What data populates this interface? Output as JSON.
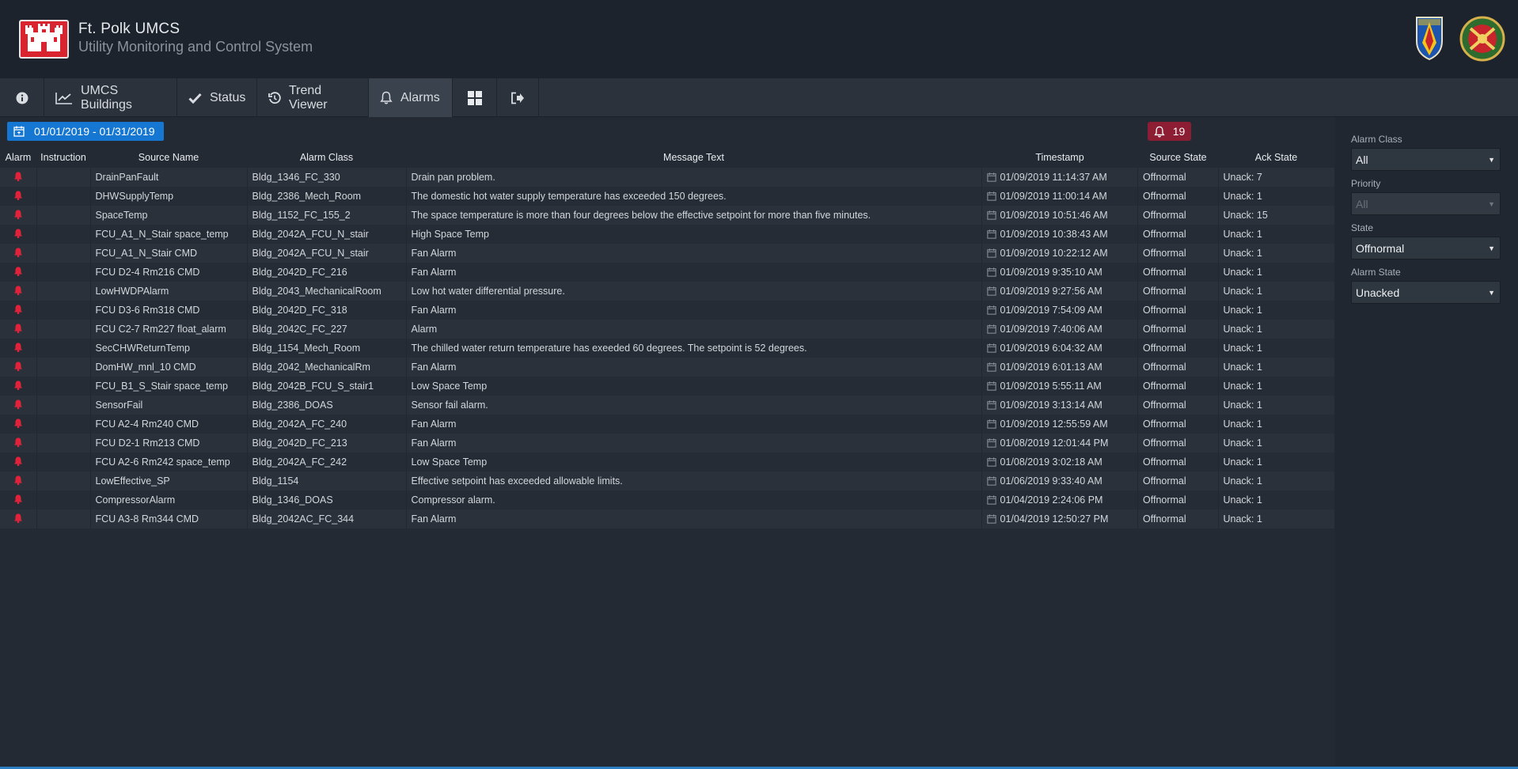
{
  "header": {
    "title": "Ft. Polk UMCS",
    "subtitle": "Utility Monitoring and Control System"
  },
  "nav": {
    "info_icon": "info-icon",
    "items": [
      {
        "label": "UMCS Buildings",
        "icon": "chart-line-icon"
      },
      {
        "label": "Status",
        "icon": "check-icon"
      },
      {
        "label": "Trend Viewer",
        "icon": "history-icon"
      },
      {
        "label": "Alarms",
        "icon": "bell-icon",
        "active": true
      }
    ],
    "grid_icon": "grid-icon",
    "logout_icon": "sign-out-icon"
  },
  "toolbar": {
    "date_range": "01/01/2019 - 01/31/2019",
    "alarm_count": "19"
  },
  "table": {
    "columns": [
      "Alarm",
      "Instruction",
      "Source Name",
      "Alarm Class",
      "Message Text",
      "Timestamp",
      "Source State",
      "Ack State"
    ],
    "rows": [
      {
        "source": "DrainPanFault",
        "alarm_class": "Bldg_1346_FC_330",
        "message": "Drain pan problem.",
        "timestamp": "01/09/2019 11:14:37 AM",
        "source_state": "Offnormal",
        "ack_state": "Unack: 7"
      },
      {
        "source": "DHWSupplyTemp",
        "alarm_class": "Bldg_2386_Mech_Room",
        "message": "The domestic hot water supply temperature has exceeded 150 degrees.",
        "timestamp": "01/09/2019 11:00:14 AM",
        "source_state": "Offnormal",
        "ack_state": "Unack: 1"
      },
      {
        "source": "SpaceTemp",
        "alarm_class": "Bldg_1152_FC_155_2",
        "message": "The space temperature is more than four degrees below the effective setpoint for more than five minutes.",
        "timestamp": "01/09/2019 10:51:46 AM",
        "source_state": "Offnormal",
        "ack_state": "Unack: 15"
      },
      {
        "source": "FCU_A1_N_Stair space_temp",
        "alarm_class": "Bldg_2042A_FCU_N_stair",
        "message": "High Space Temp",
        "timestamp": "01/09/2019 10:38:43 AM",
        "source_state": "Offnormal",
        "ack_state": "Unack: 1"
      },
      {
        "source": "FCU_A1_N_Stair CMD",
        "alarm_class": "Bldg_2042A_FCU_N_stair",
        "message": "Fan Alarm",
        "timestamp": "01/09/2019 10:22:12 AM",
        "source_state": "Offnormal",
        "ack_state": "Unack: 1"
      },
      {
        "source": "FCU D2-4 Rm216 CMD",
        "alarm_class": "Bldg_2042D_FC_216",
        "message": "Fan Alarm",
        "timestamp": "01/09/2019 9:35:10 AM",
        "source_state": "Offnormal",
        "ack_state": "Unack: 1"
      },
      {
        "source": "LowHWDPAlarm",
        "alarm_class": "Bldg_2043_MechanicalRoom",
        "message": "Low hot water differential pressure.",
        "timestamp": "01/09/2019 9:27:56 AM",
        "source_state": "Offnormal",
        "ack_state": "Unack: 1"
      },
      {
        "source": "FCU D3-6 Rm318 CMD",
        "alarm_class": "Bldg_2042D_FC_318",
        "message": "Fan Alarm",
        "timestamp": "01/09/2019 7:54:09 AM",
        "source_state": "Offnormal",
        "ack_state": "Unack: 1"
      },
      {
        "source": "FCU C2-7 Rm227 float_alarm",
        "alarm_class": "Bldg_2042C_FC_227",
        "message": "Alarm",
        "timestamp": "01/09/2019 7:40:06 AM",
        "source_state": "Offnormal",
        "ack_state": "Unack: 1"
      },
      {
        "source": "SecCHWReturnTemp",
        "alarm_class": "Bldg_1154_Mech_Room",
        "message": "The chilled water return temperature has exeeded 60 degrees. The setpoint is 52 degrees.",
        "timestamp": "01/09/2019 6:04:32 AM",
        "source_state": "Offnormal",
        "ack_state": "Unack: 1"
      },
      {
        "source": "DomHW_mnl_10 CMD",
        "alarm_class": "Bldg_2042_MechanicalRm",
        "message": "Fan Alarm",
        "timestamp": "01/09/2019 6:01:13 AM",
        "source_state": "Offnormal",
        "ack_state": "Unack: 1"
      },
      {
        "source": "FCU_B1_S_Stair space_temp",
        "alarm_class": "Bldg_2042B_FCU_S_stair1",
        "message": "Low Space Temp",
        "timestamp": "01/09/2019 5:55:11 AM",
        "source_state": "Offnormal",
        "ack_state": "Unack: 1"
      },
      {
        "source": "SensorFail",
        "alarm_class": "Bldg_2386_DOAS",
        "message": "Sensor fail alarm.",
        "timestamp": "01/09/2019 3:13:14 AM",
        "source_state": "Offnormal",
        "ack_state": "Unack: 1"
      },
      {
        "source": "FCU A2-4 Rm240 CMD",
        "alarm_class": "Bldg_2042A_FC_240",
        "message": "Fan Alarm",
        "timestamp": "01/09/2019 12:55:59 AM",
        "source_state": "Offnormal",
        "ack_state": "Unack: 1"
      },
      {
        "source": "FCU D2-1 Rm213 CMD",
        "alarm_class": "Bldg_2042D_FC_213",
        "message": "Fan Alarm",
        "timestamp": "01/08/2019 12:01:44 PM",
        "source_state": "Offnormal",
        "ack_state": "Unack: 1"
      },
      {
        "source": "FCU A2-6 Rm242 space_temp",
        "alarm_class": "Bldg_2042A_FC_242",
        "message": "Low Space Temp",
        "timestamp": "01/08/2019 3:02:18 AM",
        "source_state": "Offnormal",
        "ack_state": "Unack: 1"
      },
      {
        "source": "LowEffective_SP",
        "alarm_class": "Bldg_1154",
        "message": "Effective setpoint has exceeded allowable limits.",
        "timestamp": "01/06/2019 9:33:40 AM",
        "source_state": "Offnormal",
        "ack_state": "Unack: 1"
      },
      {
        "source": "CompressorAlarm",
        "alarm_class": "Bldg_1346_DOAS",
        "message": "Compressor alarm.",
        "timestamp": "01/04/2019 2:24:06 PM",
        "source_state": "Offnormal",
        "ack_state": "Unack: 1"
      },
      {
        "source": "FCU A3-8 Rm344 CMD",
        "alarm_class": "Bldg_2042AC_FC_344",
        "message": "Fan Alarm",
        "timestamp": "01/04/2019 12:50:27 PM",
        "source_state": "Offnormal",
        "ack_state": "Unack: 1"
      }
    ]
  },
  "filters": {
    "alarm_class": {
      "label": "Alarm Class",
      "value": "All"
    },
    "priority": {
      "label": "Priority",
      "value": "All",
      "disabled": true
    },
    "state": {
      "label": "State",
      "value": "Offnormal"
    },
    "alarm_state": {
      "label": "Alarm State",
      "value": "Unacked"
    }
  },
  "colors": {
    "accent": "#1677d2",
    "alarm_red": "#e0223a",
    "alarm_badge": "#8c1d32",
    "logo_red": "#d9232f"
  }
}
